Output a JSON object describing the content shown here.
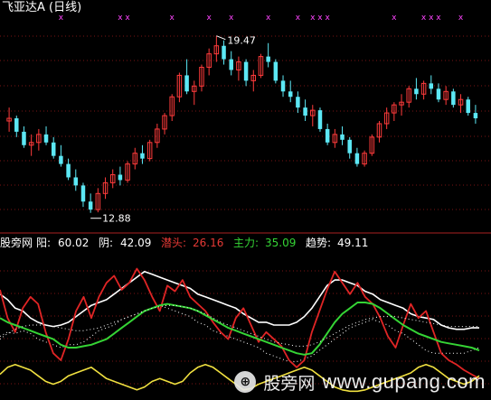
{
  "header": {
    "title": "飞亚达A (日线)"
  },
  "price_panel": {
    "high_label": "19.47",
    "low_label": "12.88",
    "dot_marker": "x"
  },
  "indicator_header": {
    "name": "股旁网",
    "items": [
      {
        "key": "阳:",
        "value": "60.02",
        "color": "#ffffff"
      },
      {
        "key": "阴:",
        "value": "42.09",
        "color": "#ffffff"
      },
      {
        "key": "潜头:",
        "value": "26.16",
        "color": "#e53935"
      },
      {
        "key": "主力:",
        "value": "35.09",
        "color": "#35d435"
      },
      {
        "key": "趋势:",
        "value": "49.11",
        "color": "#ffffff"
      }
    ]
  },
  "watermark": {
    "cn": "股旁网",
    "site": "www.gupang.com"
  },
  "colors": {
    "up": "#ff3b3b",
    "down": "#5ce8f5",
    "grid": "#7a1414",
    "divider": "#aa2222",
    "markers": "#ff44ff",
    "white_line": "#ffffff",
    "red_line": "#e02525",
    "green_line": "#35d435",
    "yellow_line": "#f0e040"
  },
  "chart_data": [
    {
      "type": "candlestick",
      "title": "飞亚达A (日线)",
      "annotations": [
        {
          "text": "19.47",
          "type": "high"
        },
        {
          "text": "12.88",
          "type": "low"
        }
      ],
      "ohlc": [
        [
          16.3,
          16.8,
          15.9,
          16.4
        ],
        [
          16.4,
          16.5,
          15.7,
          15.9
        ],
        [
          15.9,
          16.1,
          15.3,
          15.4
        ],
        [
          15.4,
          15.8,
          15.0,
          15.5
        ],
        [
          15.5,
          16.0,
          15.2,
          15.8
        ],
        [
          15.8,
          16.1,
          15.4,
          15.5
        ],
        [
          15.5,
          15.7,
          14.9,
          15.0
        ],
        [
          15.0,
          15.4,
          14.6,
          14.7
        ],
        [
          14.7,
          14.9,
          14.1,
          14.2
        ],
        [
          14.2,
          14.5,
          13.7,
          13.9
        ],
        [
          13.9,
          14.0,
          13.1,
          13.3
        ],
        [
          13.3,
          13.6,
          12.88,
          13.0
        ],
        [
          13.0,
          13.8,
          12.9,
          13.6
        ],
        [
          13.6,
          14.2,
          13.4,
          14.0
        ],
        [
          14.0,
          14.5,
          13.8,
          14.3
        ],
        [
          14.3,
          14.6,
          13.9,
          14.1
        ],
        [
          14.1,
          14.8,
          14.0,
          14.7
        ],
        [
          14.7,
          15.3,
          14.5,
          15.1
        ],
        [
          15.1,
          15.4,
          14.7,
          14.9
        ],
        [
          14.9,
          15.6,
          14.8,
          15.5
        ],
        [
          15.5,
          16.2,
          15.3,
          16.0
        ],
        [
          16.0,
          16.6,
          15.8,
          16.5
        ],
        [
          16.5,
          17.3,
          16.3,
          17.2
        ],
        [
          17.2,
          18.1,
          17.0,
          18.0
        ],
        [
          18.0,
          18.6,
          17.3,
          17.4
        ],
        [
          17.4,
          17.8,
          16.9,
          17.6
        ],
        [
          17.6,
          18.4,
          17.4,
          18.3
        ],
        [
          18.3,
          19.0,
          18.0,
          18.8
        ],
        [
          18.8,
          19.47,
          18.5,
          19.1
        ],
        [
          19.1,
          19.3,
          18.4,
          18.6
        ],
        [
          18.6,
          18.9,
          18.0,
          18.2
        ],
        [
          18.2,
          18.7,
          17.8,
          18.5
        ],
        [
          18.5,
          18.6,
          17.6,
          17.8
        ],
        [
          17.8,
          18.2,
          17.4,
          18.0
        ],
        [
          18.0,
          18.8,
          17.9,
          18.7
        ],
        [
          18.7,
          19.2,
          18.3,
          18.5
        ],
        [
          18.5,
          18.6,
          17.7,
          17.8
        ],
        [
          17.8,
          18.0,
          17.2,
          17.4
        ],
        [
          17.4,
          17.8,
          17.0,
          17.2
        ],
        [
          17.2,
          17.4,
          16.6,
          16.8
        ],
        [
          16.8,
          17.1,
          16.3,
          16.5
        ],
        [
          16.5,
          16.9,
          16.1,
          16.7
        ],
        [
          16.7,
          16.8,
          15.9,
          16.0
        ],
        [
          16.0,
          16.2,
          15.4,
          15.5
        ],
        [
          15.5,
          16.0,
          15.3,
          15.8
        ],
        [
          15.8,
          16.1,
          15.4,
          15.6
        ],
        [
          15.6,
          15.7,
          14.9,
          15.1
        ],
        [
          15.1,
          15.3,
          14.6,
          14.7
        ],
        [
          14.7,
          15.2,
          14.6,
          15.1
        ],
        [
          15.1,
          15.8,
          15.0,
          15.7
        ],
        [
          15.7,
          16.3,
          15.5,
          16.2
        ],
        [
          16.2,
          16.8,
          16.0,
          16.6
        ],
        [
          16.6,
          17.0,
          16.3,
          16.9
        ],
        [
          16.9,
          17.3,
          16.5,
          17.0
        ],
        [
          17.0,
          17.6,
          16.8,
          17.5
        ],
        [
          17.5,
          17.9,
          17.1,
          17.3
        ],
        [
          17.3,
          17.8,
          17.1,
          17.7
        ],
        [
          17.7,
          18.0,
          17.3,
          17.5
        ],
        [
          17.5,
          17.7,
          17.0,
          17.1
        ],
        [
          17.1,
          17.6,
          16.9,
          17.4
        ],
        [
          17.4,
          17.5,
          16.8,
          16.9
        ],
        [
          16.9,
          17.3,
          16.6,
          17.1
        ],
        [
          17.1,
          17.2,
          16.5,
          16.6
        ],
        [
          16.6,
          16.9,
          16.2,
          16.4
        ]
      ]
    },
    {
      "type": "line",
      "x": [
        0,
        1,
        2,
        3,
        4,
        5,
        6,
        7,
        8,
        9,
        10,
        11,
        12,
        13,
        14,
        15,
        16,
        17,
        18,
        19,
        20,
        21,
        22,
        23,
        24,
        25,
        26,
        27,
        28,
        29,
        30,
        31,
        32,
        33,
        34,
        35,
        36,
        37,
        38,
        39,
        40,
        41,
        42,
        43,
        44,
        45,
        46,
        47,
        48,
        49,
        50,
        51,
        52,
        53,
        54,
        55,
        56,
        57,
        58,
        59,
        60,
        61,
        62,
        63
      ],
      "ylim": [
        0,
        100
      ],
      "series": [
        {
          "name": "阳",
          "values": [
            72,
            68,
            62,
            60,
            55,
            52,
            50,
            49,
            50,
            52,
            56,
            60,
            64,
            66,
            68,
            72,
            76,
            80,
            84,
            88,
            86,
            84,
            82,
            80,
            78,
            76,
            72,
            70,
            68,
            66,
            64,
            62,
            58,
            55,
            52,
            52,
            50,
            50,
            50,
            52,
            56,
            62,
            70,
            78,
            82,
            82,
            80,
            78,
            74,
            72,
            68,
            66,
            64,
            62,
            58,
            56,
            55,
            54,
            50,
            48,
            47,
            47,
            48,
            48
          ]
        },
        {
          "name": "阴",
          "values": [
            42,
            45,
            44,
            46,
            44,
            40,
            38,
            36,
            34,
            36,
            36,
            38,
            42,
            46,
            48,
            50,
            54,
            56,
            58,
            60,
            62,
            64,
            62,
            60,
            58,
            56,
            52,
            50,
            46,
            44,
            42,
            40,
            38,
            36,
            34,
            30,
            28,
            26,
            24,
            24,
            26,
            28,
            32,
            36,
            40,
            44,
            48,
            50,
            52,
            54,
            52,
            50,
            46,
            44,
            40,
            36,
            32,
            30,
            30,
            30,
            30,
            30,
            32,
            34
          ]
        },
        {
          "name": "潜头",
          "values": [
            75,
            55,
            45,
            62,
            70,
            65,
            45,
            30,
            25,
            40,
            60,
            70,
            55,
            70,
            80,
            85,
            75,
            80,
            90,
            82,
            70,
            60,
            78,
            74,
            82,
            70,
            65,
            60,
            52,
            45,
            40,
            55,
            62,
            50,
            38,
            45,
            40,
            35,
            25,
            20,
            25,
            45,
            60,
            75,
            88,
            80,
            72,
            80,
            70,
            65,
            55,
            42,
            34,
            50,
            65,
            55,
            60,
            45,
            30,
            25,
            22,
            18,
            15,
            12
          ]
        },
        {
          "name": "主力",
          "values": [
            55,
            52,
            50,
            48,
            46,
            44,
            42,
            40,
            36,
            34,
            34,
            35,
            36,
            38,
            40,
            44,
            48,
            52,
            56,
            60,
            62,
            64,
            65,
            64,
            63,
            62,
            60,
            57,
            54,
            51,
            48,
            46,
            44,
            42,
            40,
            38,
            36,
            34,
            32,
            30,
            29,
            30,
            36,
            44,
            52,
            58,
            62,
            66,
            66,
            65,
            62,
            58,
            54,
            50,
            47,
            44,
            42,
            40,
            38,
            37,
            36,
            35,
            34,
            32
          ]
        },
        {
          "name": "趋势",
          "values": [
            40,
            44,
            47,
            49,
            50,
            50,
            50,
            49,
            48,
            47,
            46,
            46,
            47,
            48,
            50,
            52,
            54,
            56,
            58,
            60,
            62,
            63,
            64,
            64,
            63,
            62,
            60,
            58,
            55,
            52,
            50,
            48,
            46,
            44,
            42,
            40,
            38,
            37,
            36,
            35,
            35,
            36,
            38,
            41,
            44,
            47,
            50,
            52,
            54,
            55,
            56,
            56,
            56,
            55,
            54,
            53,
            52,
            51,
            50,
            49,
            49,
            49,
            49,
            49
          ]
        },
        {
          "name": "",
          "values": [
            15,
            20,
            22,
            20,
            18,
            14,
            10,
            8,
            10,
            14,
            16,
            18,
            20,
            16,
            12,
            10,
            8,
            6,
            4,
            6,
            10,
            12,
            10,
            8,
            10,
            16,
            20,
            22,
            20,
            16,
            12,
            8,
            4,
            5,
            8,
            10,
            12,
            14,
            16,
            18,
            20,
            18,
            14,
            10,
            6,
            4,
            3,
            3,
            4,
            6,
            8,
            10,
            12,
            14,
            16,
            20,
            22,
            20,
            16,
            12,
            10,
            8,
            10,
            14
          ]
        }
      ]
    }
  ]
}
